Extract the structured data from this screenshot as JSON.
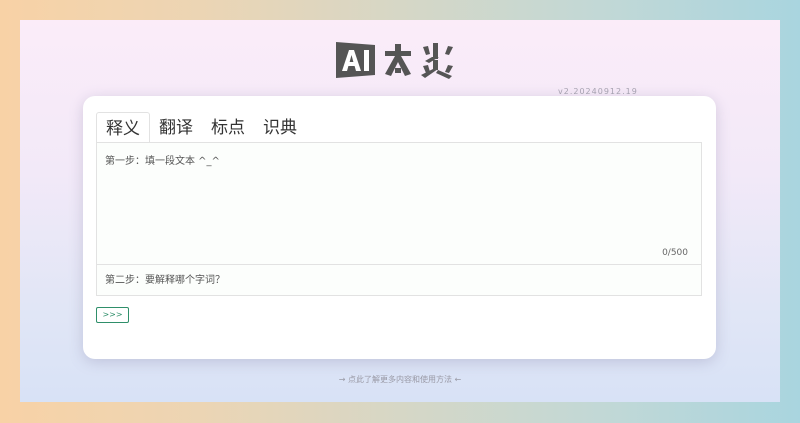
{
  "header": {
    "logo_text": "AI太炎",
    "version": "v2.20240912.19"
  },
  "tabs": [
    {
      "label": "释义",
      "active": true
    },
    {
      "label": "翻译",
      "active": false
    },
    {
      "label": "标点",
      "active": false
    },
    {
      "label": "识典",
      "active": false
    }
  ],
  "form": {
    "text_placeholder": "第一步：填一段文本 ^_^",
    "char_count": "0/500",
    "word_placeholder": "第二步：要解释哪个字词？",
    "submit_label": ">>>"
  },
  "footer": {
    "link_text": "→ 点此了解更多内容和使用方法 ←"
  },
  "colors": {
    "accent": "#2f8f6a",
    "logo": "#555555"
  }
}
